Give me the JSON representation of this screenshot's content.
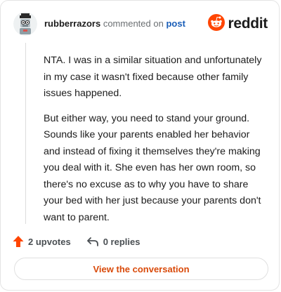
{
  "header": {
    "author": "rubberrazors",
    "action": "commented on",
    "post_link": "post",
    "brand": "reddit"
  },
  "body": {
    "paragraphs": [
      "NTA. I was in a similar situation and unfortunately in my case it wasn't fixed because other family issues happened.",
      "But either way, you need to stand your ground. Sounds like your parents enabled her behavior and instead of fixing it themselves they're making you deal with it. She even has her own room, so there's no excuse as to why you have to share your bed with her just because your parents don't want to parent."
    ]
  },
  "footer": {
    "upvotes": "2 upvotes",
    "replies": "0 replies",
    "view_button": "View the conversation"
  },
  "colors": {
    "accent": "#ff4500",
    "link": "#1a5eb8",
    "button_text": "#d94a0a"
  },
  "icons": {
    "upvote": "upvote-arrow-icon",
    "reply": "reply-arrow-icon",
    "brand": "reddit-snoo-icon",
    "avatar": "user-avatar"
  }
}
